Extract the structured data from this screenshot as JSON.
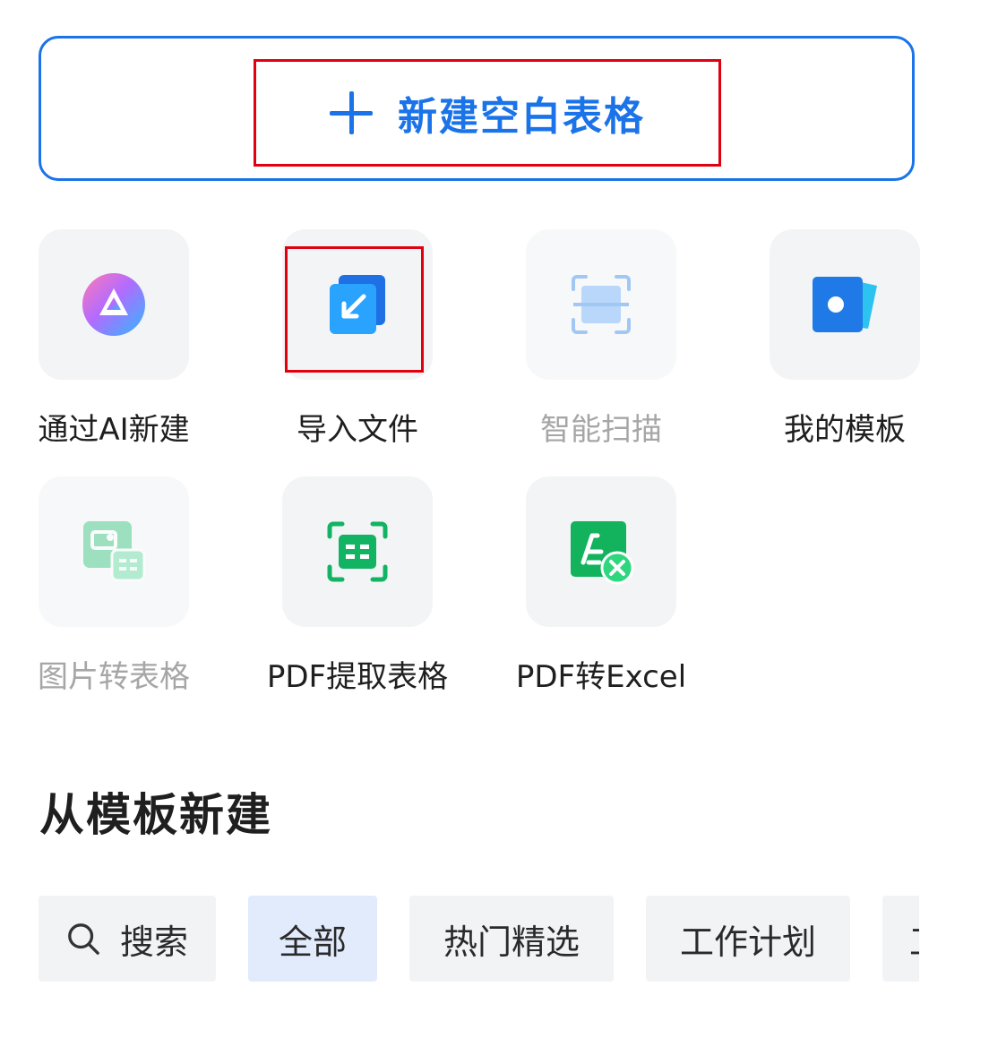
{
  "new_blank": {
    "label": "新建空白表格",
    "color": "#1a73e8"
  },
  "tools": [
    {
      "label": "通过AI新建",
      "icon": "ai-logo-icon",
      "enabled": true
    },
    {
      "label": "导入文件",
      "icon": "import-file-icon",
      "enabled": true
    },
    {
      "label": "智能扫描",
      "icon": "smart-scan-icon",
      "enabled": false
    },
    {
      "label": "我的模板",
      "icon": "my-templates-icon",
      "enabled": true
    },
    {
      "label": "图片转表格",
      "icon": "image-to-table-icon",
      "enabled": false
    },
    {
      "label": "PDF提取表格",
      "icon": "pdf-extract-table-icon",
      "enabled": true
    },
    {
      "label": "PDF转Excel",
      "icon": "pdf-to-excel-icon",
      "enabled": true
    }
  ],
  "templates_section": {
    "title": "从模板新建"
  },
  "chips": [
    {
      "label": "搜索",
      "icon": "search-icon"
    },
    {
      "label": "全部",
      "active": true
    },
    {
      "label": "热门精选"
    },
    {
      "label": "工作计划"
    },
    {
      "label": "工"
    }
  ],
  "colors": {
    "accent": "#1a73e8",
    "highlight": "#e0000f",
    "chip_active": "#e1ebfc"
  }
}
